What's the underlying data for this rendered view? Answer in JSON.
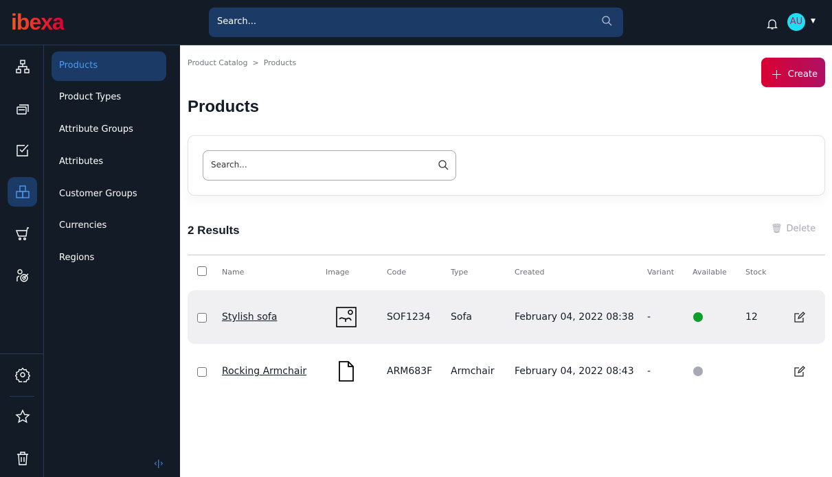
{
  "header": {
    "logo": "ibexa",
    "search_placeholder": "Search...",
    "avatar_initials": "AU"
  },
  "rail": {
    "icons": [
      "content-tree-icon",
      "content-icon",
      "review-icon",
      "product-catalog-icon",
      "cart-icon",
      "customer-target-icon",
      "settings-icon",
      "bookmarks-icon",
      "trash-icon"
    ]
  },
  "submenu": {
    "items": [
      "Products",
      "Product Types",
      "Attribute Groups",
      "Attributes",
      "Customer Groups",
      "Currencies",
      "Regions"
    ],
    "active": "Products"
  },
  "breadcrumb": [
    "Product Catalog",
    "Products"
  ],
  "create_label": "Create",
  "page_title": "Products",
  "filter": {
    "search_placeholder": "Search..."
  },
  "results_label": "2 Results",
  "delete_label": "Delete",
  "table": {
    "headers": [
      "Name",
      "Image",
      "Code",
      "Type",
      "Created",
      "Variant",
      "Available",
      "Stock"
    ],
    "rows": [
      {
        "name": "Stylish sofa",
        "image": "image-icon",
        "code": "SOF1234",
        "type": "Sofa",
        "created": "February 04, 2022 08:38",
        "variant": "-",
        "available": true,
        "stock": "12"
      },
      {
        "name": "Rocking Armchair",
        "image": "file-icon",
        "code": "ARM683F",
        "type": "Armchair",
        "created": "February 04, 2022 08:43",
        "variant": "-",
        "available": false,
        "stock": ""
      }
    ]
  },
  "colors": {
    "accent": "#db0032",
    "available": "#0c9f2a",
    "unavailable": "#a8a8b4",
    "sidebar": "#131c26",
    "active_item": "#1b3a66"
  }
}
